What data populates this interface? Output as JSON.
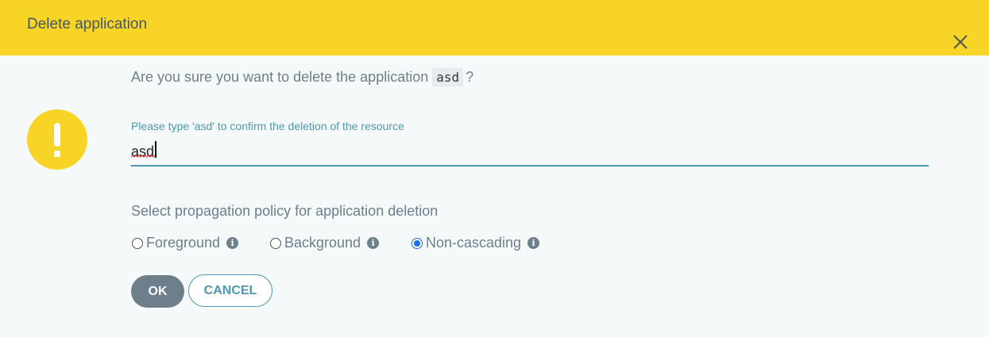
{
  "dialog": {
    "title": "Delete application",
    "question_prefix": "Are you sure you want to delete the application",
    "app_name": "asd",
    "question_suffix": "?",
    "confirm": {
      "label": "Please type 'asd' to confirm the deletion of the resource",
      "value": "asd"
    },
    "policy": {
      "title": "Select propagation policy for application deletion",
      "options": [
        {
          "label": "Foreground",
          "checked": false
        },
        {
          "label": "Background",
          "checked": false
        },
        {
          "label": "Non-cascading",
          "checked": true
        }
      ],
      "info_glyph": "i"
    },
    "buttons": {
      "ok": "OK",
      "cancel": "CANCEL"
    }
  },
  "icons": {
    "close": "close-icon",
    "warning": "exclamation-icon",
    "info": "info-icon"
  },
  "colors": {
    "header": "#f8d427",
    "accent": "#4e99ae",
    "text": "#6d7f8b",
    "radio_selected": "#1a73e8"
  }
}
